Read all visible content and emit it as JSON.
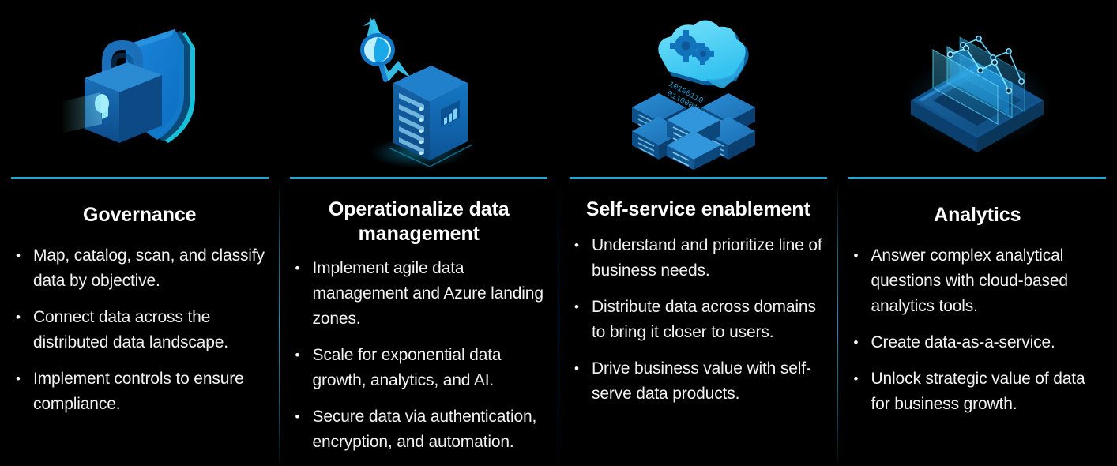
{
  "slide": {
    "background_color": "#000000",
    "accent_color": "#1aa8d8",
    "text_color": "#f2f2f2",
    "columns": [
      {
        "id": "governance",
        "icon_name": "shield-lock-icon",
        "title": "Governance",
        "bullets": [
          "Map, catalog, scan, and classify data by objective.",
          "Connect data across the distributed data landscape.",
          "Implement controls to ensure compliance."
        ]
      },
      {
        "id": "operationalize-data-management",
        "icon_name": "server-monitoring-icon",
        "title": "Operationalize data management",
        "bullets": [
          "Implement agile data management and Azure landing zones.",
          "Scale for exponential data growth, analytics, and AI.",
          "Secure data via authentication, encryption, and automation."
        ]
      },
      {
        "id": "self-service-enablement",
        "icon_name": "cloud-data-icon",
        "title": "Self-service enablement",
        "bullets": [
          "Understand and prioritize line of business needs.",
          "Distribute data across domains to bring it closer to users.",
          "Drive business value with self-serve data products."
        ]
      },
      {
        "id": "analytics",
        "icon_name": "analytics-chart-icon",
        "title": "Analytics",
        "bullets": [
          "Answer complex analytical questions with cloud-based analytics tools.",
          "Create data-as-a-service.",
          "Unlock strategic value of data for business growth."
        ]
      }
    ]
  }
}
